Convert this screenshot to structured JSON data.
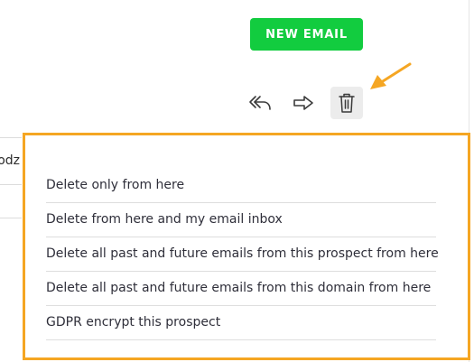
{
  "toolbar": {
    "new_email_label": "NEW EMAIL",
    "icons": [
      "reply-all-icon",
      "forward-icon",
      "trash-icon"
    ]
  },
  "background": {
    "row_fragment": "odz"
  },
  "delete_menu": {
    "items": [
      {
        "label": "Delete only from here"
      },
      {
        "label": "Delete from here and my email inbox"
      },
      {
        "label": "Delete all past and future emails from this prospect from here"
      },
      {
        "label": "Delete all past and future emails from this domain from here"
      },
      {
        "label": "GDPR encrypt this prospect"
      }
    ]
  },
  "colors": {
    "accent_green": "#12cc3f",
    "highlight_orange": "#f5a623",
    "icon_gray": "#3a3a3a"
  }
}
